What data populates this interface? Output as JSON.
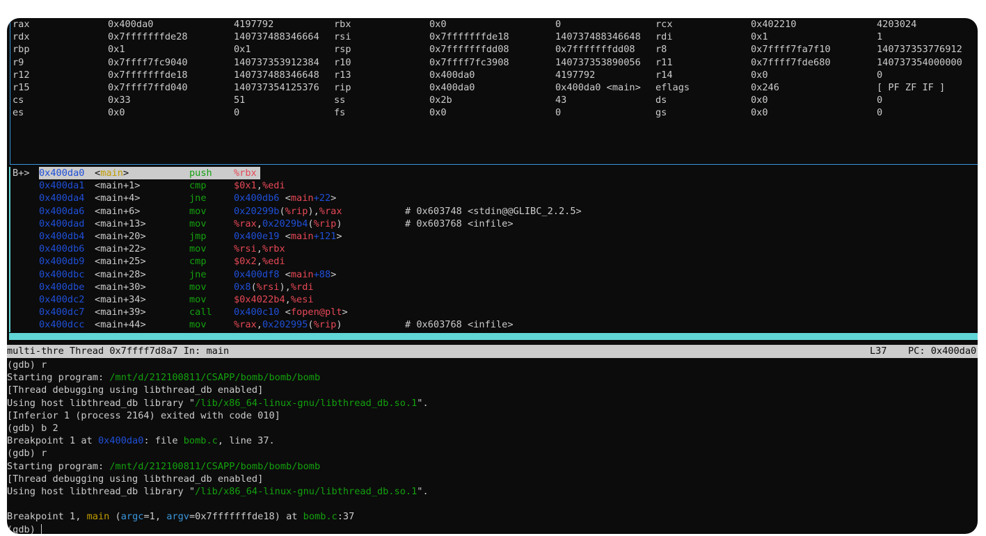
{
  "registers": [
    [
      [
        "rax",
        "0x400da0",
        "4197792"
      ],
      [
        "rbx",
        "0x0",
        "0"
      ],
      [
        "rcx",
        "0x402210",
        "4203024"
      ]
    ],
    [
      [
        "rdx",
        "0x7fffffffde28",
        "140737488346664"
      ],
      [
        "rsi",
        "0x7fffffffde18",
        "140737488346648"
      ],
      [
        "rdi",
        "0x1",
        "1"
      ]
    ],
    [
      [
        "rbp",
        "0x1",
        "0x1"
      ],
      [
        "rsp",
        "0x7fffffffdd08",
        "0x7fffffffdd08"
      ],
      [
        "r8",
        "0x7ffff7fa7f10",
        "140737353776912"
      ]
    ],
    [
      [
        "r9",
        "0x7ffff7fc9040",
        "140737353912384"
      ],
      [
        "r10",
        "0x7ffff7fc3908",
        "140737353890056"
      ],
      [
        "r11",
        "0x7ffff7fde680",
        "140737354000000"
      ]
    ],
    [
      [
        "r12",
        "0x7fffffffde18",
        "140737488346648"
      ],
      [
        "r13",
        "0x400da0",
        "4197792"
      ],
      [
        "r14",
        "0x0",
        "0"
      ]
    ],
    [
      [
        "r15",
        "0x7ffff7ffd040",
        "140737354125376"
      ],
      [
        "rip",
        "0x400da0",
        "0x400da0 <main>"
      ],
      [
        "eflags",
        "0x246",
        "[ PF ZF IF ]"
      ]
    ],
    [
      [
        "cs",
        "0x33",
        "51"
      ],
      [
        "ss",
        "0x2b",
        "43"
      ],
      [
        "ds",
        "0x0",
        "0"
      ]
    ],
    [
      [
        "es",
        "0x0",
        "0"
      ],
      [
        "fs",
        "0x0",
        "0"
      ],
      [
        "gs",
        "0x0",
        "0"
      ]
    ]
  ],
  "asm": [
    {
      "marker": "B+>",
      "addr": "0x400da0",
      "fn": "main",
      "off": "",
      "op": "push",
      "args": [
        [
          "%rbx",
          "r"
        ]
      ],
      "comment": ""
    },
    {
      "marker": "",
      "addr": "0x400da1",
      "fn": "main",
      "off": "+1",
      "op": "cmp",
      "args": [
        [
          "$0x1",
          "r"
        ],
        [
          ",",
          "w"
        ],
        [
          "%edi",
          "r"
        ]
      ],
      "comment": ""
    },
    {
      "marker": "",
      "addr": "0x400da4",
      "fn": "main",
      "off": "+4",
      "op": "jne",
      "args": [
        [
          "0x400db6",
          "b"
        ],
        [
          " <",
          "w"
        ],
        [
          "main",
          "r"
        ],
        [
          "+22",
          "b"
        ],
        [
          ">",
          "w"
        ]
      ],
      "comment": ""
    },
    {
      "marker": "",
      "addr": "0x400da6",
      "fn": "main",
      "off": "+6",
      "op": "mov",
      "args": [
        [
          "0x20299b",
          "b"
        ],
        [
          "(",
          "w"
        ],
        [
          "%rip",
          "r"
        ],
        [
          "),",
          "w"
        ],
        [
          "%rax",
          "r"
        ]
      ],
      "comment": "# 0x603748 <stdin@@GLIBC_2.2.5>"
    },
    {
      "marker": "",
      "addr": "0x400dad",
      "fn": "main",
      "off": "+13",
      "op": "mov",
      "args": [
        [
          "%rax",
          "r"
        ],
        [
          ",",
          "w"
        ],
        [
          "0x2029b4",
          "b"
        ],
        [
          "(",
          "w"
        ],
        [
          "%rip",
          "r"
        ],
        [
          ")",
          "w"
        ]
      ],
      "comment": "# 0x603768 <infile>"
    },
    {
      "marker": "",
      "addr": "0x400db4",
      "fn": "main",
      "off": "+20",
      "op": "jmp",
      "args": [
        [
          "0x400e19",
          "b"
        ],
        [
          " <",
          "w"
        ],
        [
          "main",
          "r"
        ],
        [
          "+121",
          "b"
        ],
        [
          ">",
          "w"
        ]
      ],
      "comment": ""
    },
    {
      "marker": "",
      "addr": "0x400db6",
      "fn": "main",
      "off": "+22",
      "op": "mov",
      "args": [
        [
          "%rsi",
          "r"
        ],
        [
          ",",
          "w"
        ],
        [
          "%rbx",
          "r"
        ]
      ],
      "comment": ""
    },
    {
      "marker": "",
      "addr": "0x400db9",
      "fn": "main",
      "off": "+25",
      "op": "cmp",
      "args": [
        [
          "$0x2",
          "r"
        ],
        [
          ",",
          "w"
        ],
        [
          "%edi",
          "r"
        ]
      ],
      "comment": ""
    },
    {
      "marker": "",
      "addr": "0x400dbc",
      "fn": "main",
      "off": "+28",
      "op": "jne",
      "args": [
        [
          "0x400df8",
          "b"
        ],
        [
          " <",
          "w"
        ],
        [
          "main",
          "r"
        ],
        [
          "+88",
          "b"
        ],
        [
          ">",
          "w"
        ]
      ],
      "comment": ""
    },
    {
      "marker": "",
      "addr": "0x400dbe",
      "fn": "main",
      "off": "+30",
      "op": "mov",
      "args": [
        [
          "0x8",
          "b"
        ],
        [
          "(",
          "w"
        ],
        [
          "%rsi",
          "r"
        ],
        [
          "),",
          "w"
        ],
        [
          "%rdi",
          "r"
        ]
      ],
      "comment": ""
    },
    {
      "marker": "",
      "addr": "0x400dc2",
      "fn": "main",
      "off": "+34",
      "op": "mov",
      "args": [
        [
          "$0x4022b4",
          "r"
        ],
        [
          ",",
          "w"
        ],
        [
          "%esi",
          "r"
        ]
      ],
      "comment": ""
    },
    {
      "marker": "",
      "addr": "0x400dc7",
      "fn": "main",
      "off": "+39",
      "op": "call",
      "args": [
        [
          "0x400c10",
          "b"
        ],
        [
          " <",
          "w"
        ],
        [
          "fopen@plt",
          "r"
        ],
        [
          ">",
          "w"
        ]
      ],
      "comment": ""
    },
    {
      "marker": "",
      "addr": "0x400dcc",
      "fn": "main",
      "off": "+44",
      "op": "mov",
      "args": [
        [
          "%rax",
          "r"
        ],
        [
          ",",
          "w"
        ],
        [
          "0x202995",
          "b"
        ],
        [
          "(",
          "w"
        ],
        [
          "%rip",
          "r"
        ],
        [
          ")",
          "w"
        ]
      ],
      "comment": "# 0x603768 <infile>"
    }
  ],
  "status": {
    "left": "multi-thre Thread 0x7ffff7d8a7 In: main",
    "line": "L37",
    "pc": "PC: 0x400da0"
  },
  "cmd": [
    [
      [
        "(gdb) r",
        "w"
      ]
    ],
    [
      [
        "Starting program: ",
        "w"
      ],
      [
        "/mnt/d/212100811/CSAPP/bomb/bomb/bomb",
        "g"
      ]
    ],
    [
      [
        "[Thread debugging using libthread_db enabled]",
        "w"
      ]
    ],
    [
      [
        "Using host libthread_db library \"",
        "w"
      ],
      [
        "/lib/x86_64-linux-gnu/libthread_db.so.1",
        "g"
      ],
      [
        "\".",
        "w"
      ]
    ],
    [
      [
        "[Inferior 1 (process 2164) exited with code 010]",
        "w"
      ]
    ],
    [
      [
        "(gdb) b 2",
        "w"
      ]
    ],
    [
      [
        "Breakpoint 1 at ",
        "w"
      ],
      [
        "0x400da0",
        "b"
      ],
      [
        ": file ",
        "w"
      ],
      [
        "bomb.c",
        "g"
      ],
      [
        ", line 37.",
        "w"
      ]
    ],
    [
      [
        "(gdb) r",
        "w"
      ]
    ],
    [
      [
        "Starting program: ",
        "w"
      ],
      [
        "/mnt/d/212100811/CSAPP/bomb/bomb/bomb",
        "g"
      ]
    ],
    [
      [
        "[Thread debugging using libthread_db enabled]",
        "w"
      ]
    ],
    [
      [
        "Using host libthread_db library \"",
        "w"
      ],
      [
        "/lib/x86_64-linux-gnu/libthread_db.so.1",
        "g"
      ],
      [
        "\".",
        "w"
      ]
    ],
    [
      [
        "",
        "w"
      ]
    ],
    [
      [
        "Breakpoint 1, ",
        "w"
      ],
      [
        "main",
        "y"
      ],
      [
        " (",
        "w"
      ],
      [
        "argc",
        "c"
      ],
      [
        "=1, ",
        "w"
      ],
      [
        "argv",
        "c"
      ],
      [
        "=0x7fffffffde18) at ",
        "w"
      ],
      [
        "bomb.c",
        "g"
      ],
      [
        ":37",
        "w"
      ]
    ],
    [
      [
        "(gdb) ",
        "w"
      ]
    ]
  ]
}
